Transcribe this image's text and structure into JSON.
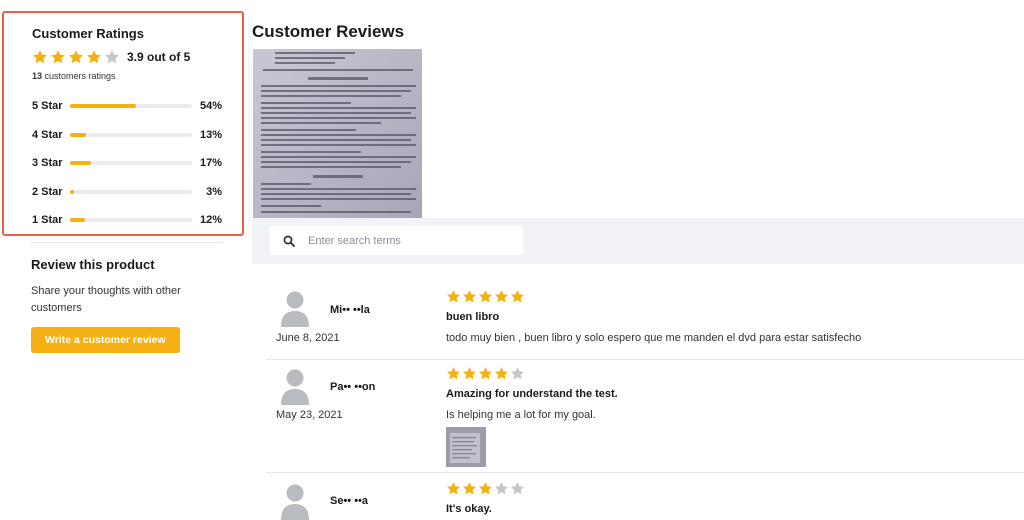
{
  "ratings": {
    "title": "Customer Ratings",
    "average_text": "3.9 out of 5",
    "average_stars": 3.9,
    "count": "13",
    "count_suffix": "customers ratings",
    "distribution": [
      {
        "label": "5 Star",
        "percent": 54,
        "percent_text": "54%"
      },
      {
        "label": "4 Star",
        "percent": 13,
        "percent_text": "13%"
      },
      {
        "label": "3 Star",
        "percent": 17,
        "percent_text": "17%"
      },
      {
        "label": "2 Star",
        "percent": 3,
        "percent_text": "3%"
      },
      {
        "label": "1 Star",
        "percent": 12,
        "percent_text": "12%"
      }
    ]
  },
  "review_product": {
    "title": "Review this product",
    "text": "Share your thoughts with other customers",
    "button_label": "Write a customer review"
  },
  "reviews_section": {
    "title": "Customer Reviews",
    "search_placeholder": "Enter search terms"
  },
  "reviews": [
    {
      "name": "Mi•• ••la",
      "date": "June 8, 2021",
      "stars": 5,
      "title": "buen libro",
      "body": "todo muy bien , buen libro y solo espero que me manden el dvd para estar satisfecho",
      "has_image": false
    },
    {
      "name": "Pa•• ••on",
      "date": "May 23, 2021",
      "stars": 4,
      "title": "Amazing for understand the test.",
      "body": "Is helping me a lot for my goal.",
      "has_image": true
    },
    {
      "name": "Se•• ••a",
      "date": "",
      "stars": 3,
      "title": "It's okay.",
      "body": "",
      "has_image": false
    }
  ],
  "colors": {
    "accent": "#f5b014",
    "star_empty": "#c4c6ca",
    "highlight_border": "#e8604c",
    "search_band": "#f2f3f6"
  }
}
